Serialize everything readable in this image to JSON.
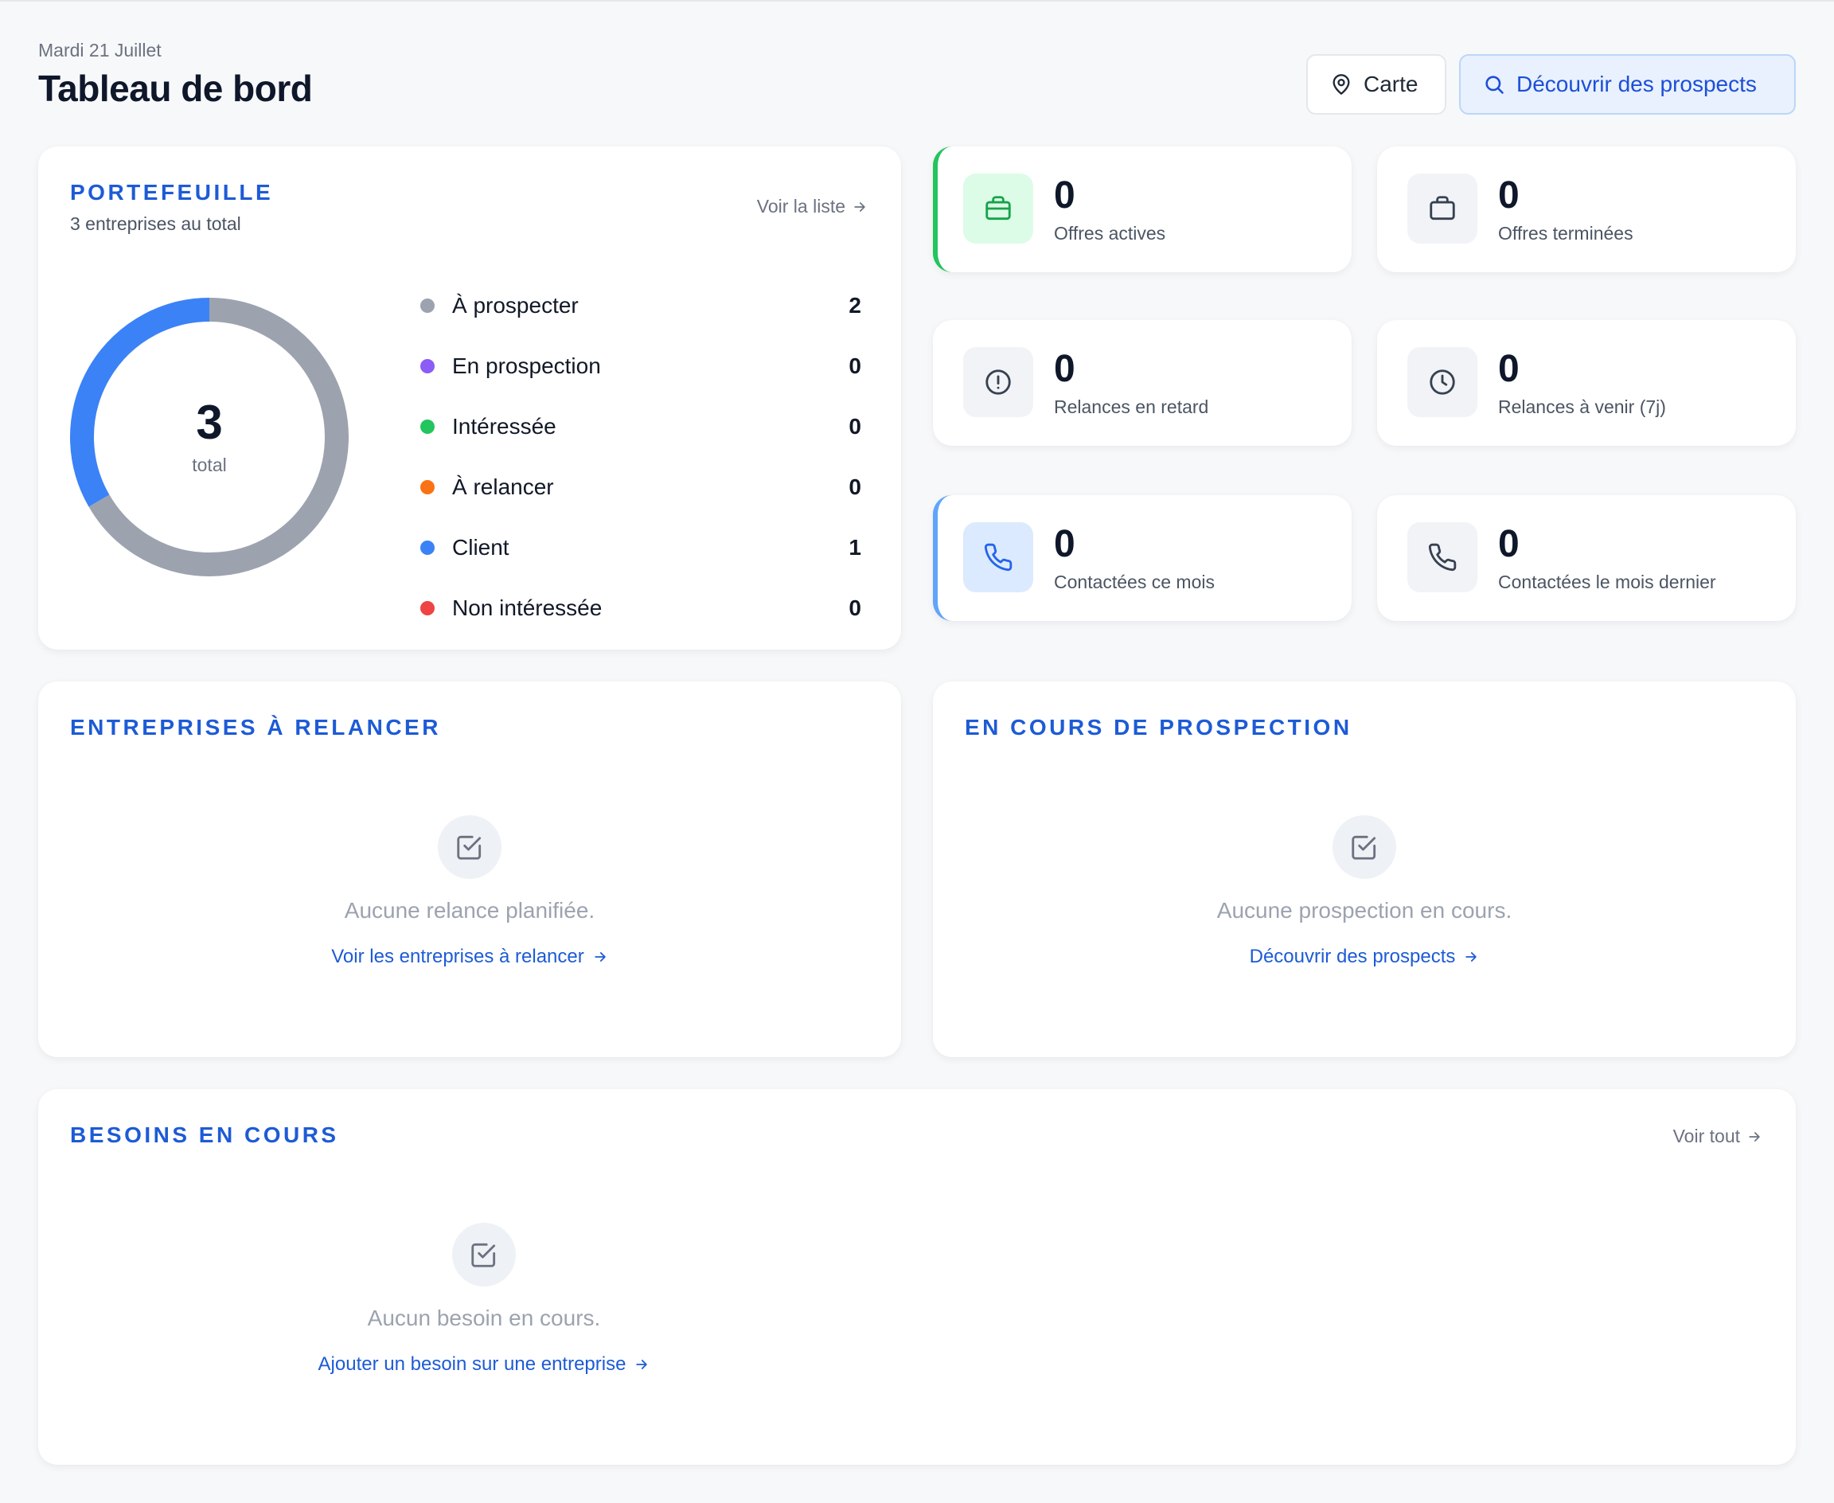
{
  "header": {
    "date": "Mardi 21 Juillet",
    "title": "Tableau de bord",
    "map_button": "Carte",
    "discover_button": "Découvrir des prospects"
  },
  "portfolio": {
    "title": "PORTEFEUILLE",
    "subtitle": "3 entreprises au total",
    "see_list": "Voir la liste",
    "total": "3",
    "total_label": "total",
    "statuses": [
      {
        "label": "À prospecter",
        "count": 2,
        "color": "#9ca3af"
      },
      {
        "label": "En prospection",
        "count": 0,
        "color": "#8b5cf6"
      },
      {
        "label": "Intéressée",
        "count": 0,
        "color": "#22c55e"
      },
      {
        "label": "À relancer",
        "count": 0,
        "color": "#f97316"
      },
      {
        "label": "Client",
        "count": 1,
        "color": "#3b82f6"
      },
      {
        "label": "Non intéressée",
        "count": 0,
        "color": "#ef4444"
      }
    ]
  },
  "stats": [
    {
      "value": "0",
      "label": "Offres actives",
      "icon": "briefcase-icon"
    },
    {
      "value": "0",
      "label": "Offres terminées",
      "icon": "briefcase-icon"
    },
    {
      "value": "0",
      "label": "Relances en retard",
      "icon": "alert-circle-icon"
    },
    {
      "value": "0",
      "label": "Relances à venir (7j)",
      "icon": "clock-icon"
    },
    {
      "value": "0",
      "label": "Contactées ce mois",
      "icon": "phone-icon"
    },
    {
      "value": "0",
      "label": "Contactées le mois dernier",
      "icon": "phone-icon"
    }
  ],
  "followups": {
    "title": "ENTREPRISES À RELANCER",
    "empty_text": "Aucune relance planifiée.",
    "link": "Voir les entreprises à relancer"
  },
  "prospecting": {
    "title": "EN COURS DE PROSPECTION",
    "empty_text": "Aucune prospection en cours.",
    "link": "Découvrir des prospects"
  },
  "needs": {
    "title": "BESOINS EN COURS",
    "see_all": "Voir tout",
    "empty_text": "Aucun besoin en cours.",
    "link": "Ajouter un besoin sur une entreprise"
  },
  "colors": {
    "accent": "#1d5bd6",
    "green": "#22c55e",
    "blue": "#3b82f6",
    "grey": "#9ca3af"
  }
}
